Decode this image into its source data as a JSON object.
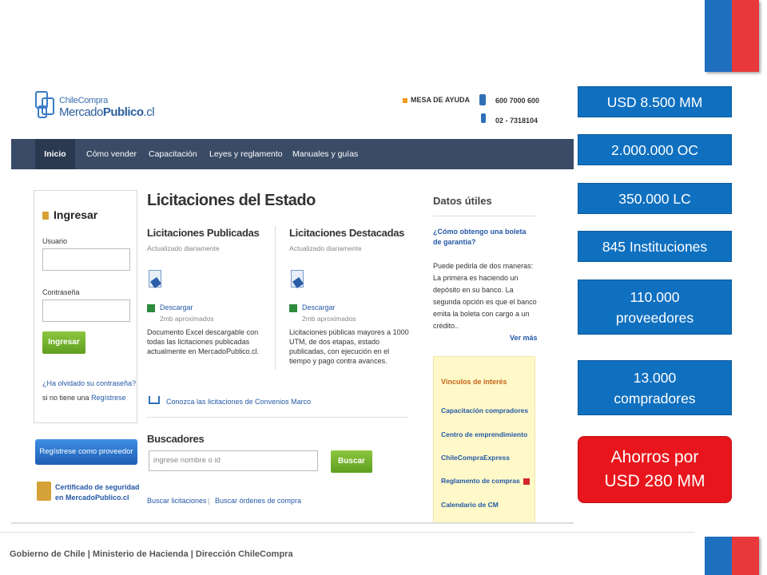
{
  "site": {
    "logo_top": "ChileCompra",
    "logo_bottom_a": "Mercado",
    "logo_bottom_b": "Publico",
    "logo_bottom_c": ".cl",
    "help_label": "MESA DE AYUDA",
    "phone_1": "600 7000 600",
    "phone_2": "02 - 7318104"
  },
  "nav": [
    "Inicio",
    "Cómo vender",
    "Capacitación",
    "Leyes y reglamento",
    "Manuales y guías"
  ],
  "login": {
    "title": "Ingresar",
    "user_label": "Usuario",
    "pass_label": "Contraseña",
    "button": "Ingresar",
    "forgot": "¿Ha olvidado su contraseña?",
    "no_account": "si no tiene una",
    "register": "Regístrese"
  },
  "register_provider": "Regístrese como proveedor",
  "certificate": "Certificado de seguridad en MercadoPublico.cl",
  "main": {
    "title": "Licitaciones del Estado",
    "published": {
      "title": "Licitaciones Publicadas",
      "sub": "Actualizado diariamente",
      "download": "Descargar",
      "size": "2mb aproximados",
      "desc": "Documento Excel descargable con todas las licitaciones publicadas actualmente en MercadoPublico.cl."
    },
    "featured": {
      "title": "Licitaciones Destacadas",
      "sub": "Actualizado diariamente",
      "download": "Descargar",
      "size": "2mb aproximados",
      "desc": "Licitaciones públicas mayores a 1000 UTM, de dos etapas, estado publicadas, con ejecución en el tiempo y pago contra avances."
    },
    "convenios": "Conozca las licitaciones de Convenios Marco",
    "search_title": "Buscadores",
    "search_placeholder": "ingrese nombre o id",
    "search_button": "Buscar",
    "link_licitaciones": "Buscar licitaciones",
    "link_separator": "|",
    "link_ordenes": "Buscar órdenes de compra"
  },
  "datos": {
    "title": "Datos útiles",
    "question": "¿Cómo obtengo una boleta de garantía?",
    "answer": "Puede pedirla de dos maneras: La primera es haciendo un depósito en su banco. La segunda opción es que el banco emita la boleta con cargo a un crédito..",
    "more": "Ver más",
    "links_title": "Vínculos de interés",
    "links": [
      "Capacitación compradores",
      "Centro de emprendimiento",
      "ChileCompraExpress",
      "Reglamento de compras",
      "Calendario de CM"
    ]
  },
  "stats": [
    "USD 8.500 MM",
    "2.000.000 OC",
    "350.000 LC",
    "845 Instituciones",
    "110.000 proveedores",
    "13.000 compradores"
  ],
  "highlight": "Ahorros por USD 280 MM",
  "footer": "Gobierno de Chile | Ministerio de Hacienda | Dirección ChileCompra",
  "colors": {
    "stat_blue": "#1070c0",
    "highlight_red": "#e8161c",
    "flag_blue": "#1f6fbf",
    "flag_red": "#e8383c"
  }
}
